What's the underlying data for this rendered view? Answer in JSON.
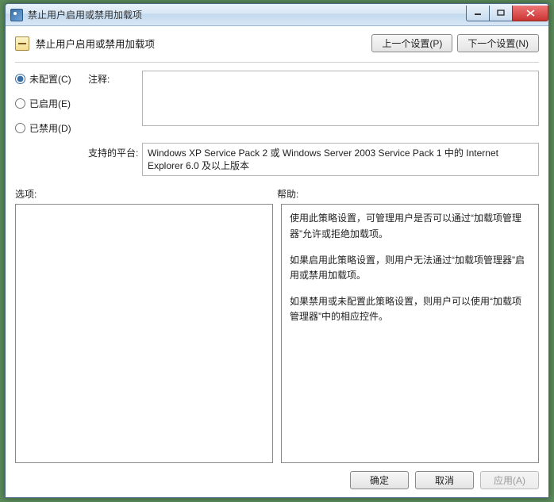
{
  "window": {
    "title": "禁止用户启用或禁用加载项"
  },
  "header": {
    "title": "禁止用户启用或禁用加载项",
    "prev_button": "上一个设置(P)",
    "next_button": "下一个设置(N)"
  },
  "radios": {
    "not_configured": "未配置(C)",
    "enabled": "已启用(E)",
    "disabled": "已禁用(D)",
    "selected": "not_configured"
  },
  "labels": {
    "comment": "注释:",
    "platform": "支持的平台:",
    "options": "选项:",
    "help": "帮助:"
  },
  "comment_value": "",
  "platform_text": "Windows XP Service Pack 2 或 Windows Server 2003 Service Pack 1 中的 Internet Explorer 6.0 及以上版本",
  "help": {
    "p1": "使用此策略设置，可管理用户是否可以通过“加载项管理器”允许或拒绝加载项。",
    "p2": "如果启用此策略设置，则用户无法通过“加载项管理器”启用或禁用加载项。",
    "p3": "如果禁用或未配置此策略设置，则用户可以使用“加载项管理器”中的相应控件。"
  },
  "footer": {
    "ok": "确定",
    "cancel": "取消",
    "apply": "应用(A)"
  }
}
